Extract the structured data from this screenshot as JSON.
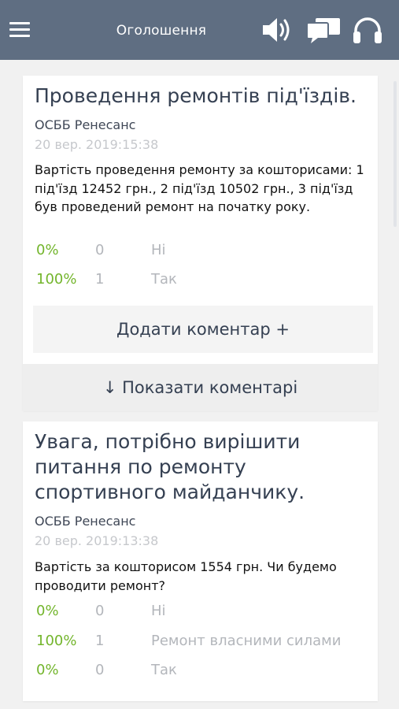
{
  "header": {
    "title": "Оголошення",
    "bg_color": "#5f6e82",
    "icons": [
      "menu-icon",
      "speaker-icon",
      "chat-icon",
      "headset-icon"
    ]
  },
  "posts": [
    {
      "title": "Проведення ремонтів під'їздів.",
      "org": "ОСББ Ренесанс",
      "date": "20 вер. 2019:15:38",
      "body": "Вартість проведення ремонту за кошторисами: 1 під'їзд 12452 грн., 2 під'їзд 10502 грн., 3 під'їзд був проведений ремонт на початку року.",
      "poll": [
        {
          "pct": "0%",
          "count": "0",
          "option": "Ні"
        },
        {
          "pct": "100%",
          "count": "1",
          "option": "Так"
        }
      ],
      "add_comment": "Додати коментар +",
      "show_comments": "↓ Показати коментарі"
    },
    {
      "title": "Увага, потрібно вирішити питання по ремонту спортивного майданчику.",
      "org": "ОСББ Ренесанс",
      "date": "20 вер. 2019:13:38",
      "body": "Вартість за кошторисом 1554 грн. Чи будемо проводити ремонт?",
      "poll": [
        {
          "pct": "0%",
          "count": "0",
          "option": "Ні"
        },
        {
          "pct": "100%",
          "count": "1",
          "option": "Ремонт власними силами"
        },
        {
          "pct": "0%",
          "count": "0",
          "option": "Так"
        }
      ]
    }
  ],
  "colors": {
    "accent_green": "#73b52c",
    "text_dark": "#354052",
    "muted": "#b3b6bb"
  }
}
